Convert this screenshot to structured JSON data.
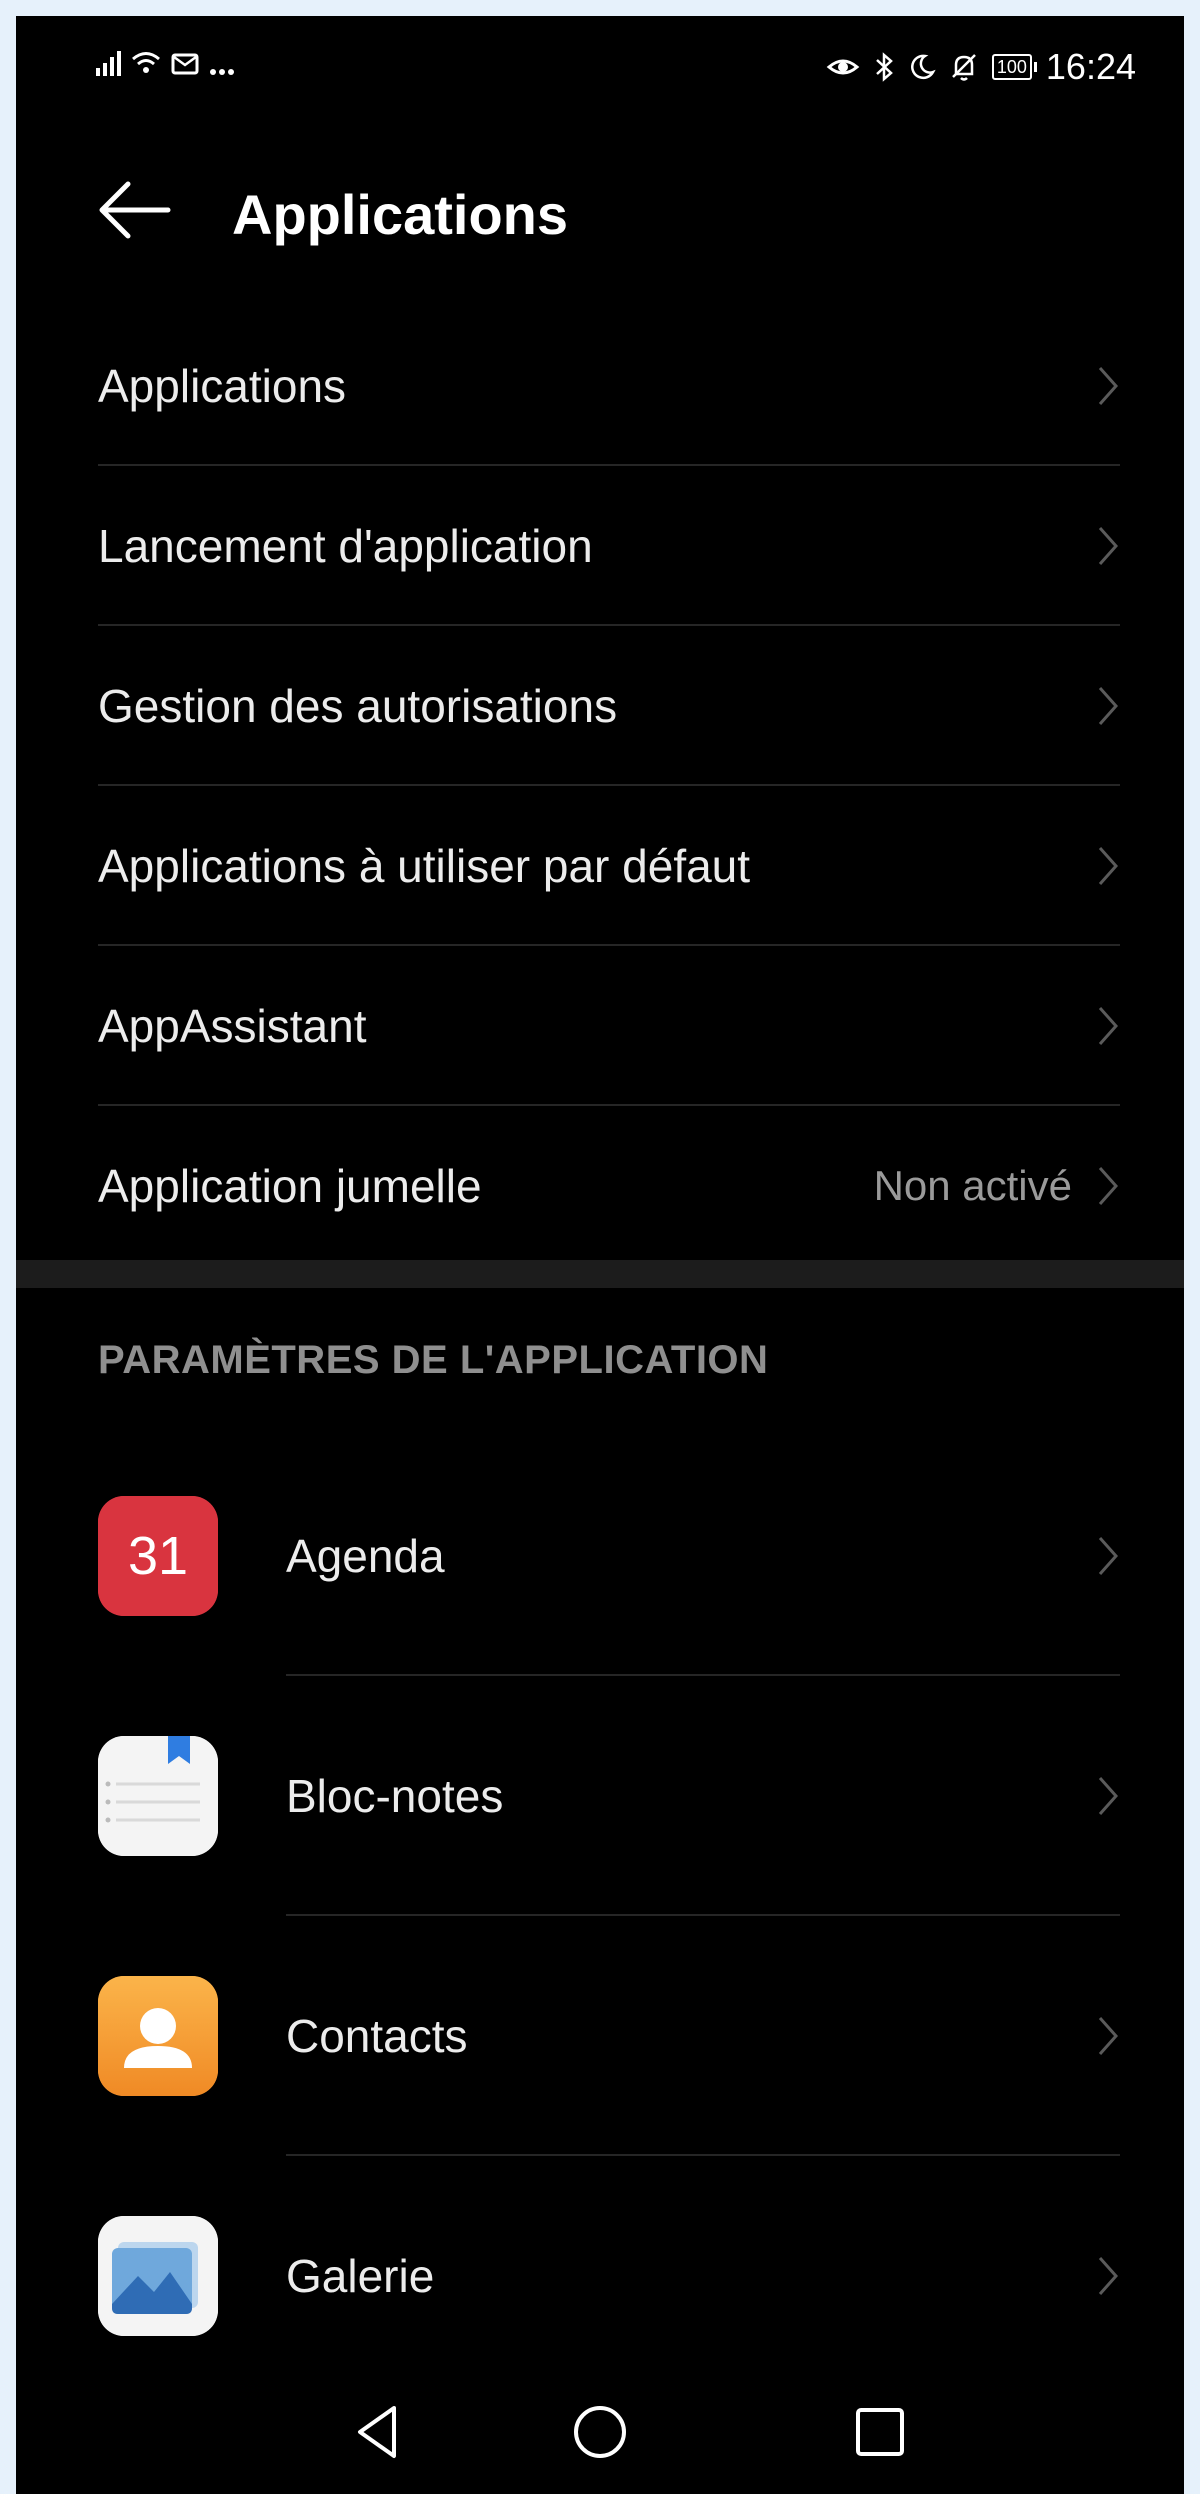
{
  "status_bar": {
    "left_icons": [
      "signal-icon",
      "wifi-icon",
      "message-icon",
      "more-dots-icon"
    ],
    "right_icons": [
      "eye-comfort-icon",
      "bluetooth-icon",
      "do-not-disturb-icon",
      "mute-icon"
    ],
    "battery": "100",
    "time": "16:24"
  },
  "header": {
    "title": "Applications"
  },
  "menu": {
    "items": [
      {
        "label": "Applications",
        "value": ""
      },
      {
        "label": "Lancement d'application",
        "value": ""
      },
      {
        "label": "Gestion des autorisations",
        "value": ""
      },
      {
        "label": "Applications à utiliser par défaut",
        "value": ""
      },
      {
        "label": "AppAssistant",
        "value": ""
      },
      {
        "label": "Application jumelle",
        "value": "Non activé"
      }
    ]
  },
  "section": {
    "title": "PARAMÈTRES DE L'APPLICATION"
  },
  "apps": {
    "items": [
      {
        "name": "Agenda",
        "icon": "calendar-icon",
        "icon_text": "31",
        "color": "#d9343f"
      },
      {
        "name": "Bloc-notes",
        "icon": "notepad-icon",
        "color": "#ffffff"
      },
      {
        "name": "Contacts",
        "icon": "contacts-icon",
        "color": "#f7a23a"
      },
      {
        "name": "Galerie",
        "icon": "gallery-icon",
        "color": "#ffffff"
      }
    ]
  },
  "nav_bar": {
    "buttons": [
      "back-nav-icon",
      "home-nav-icon",
      "recents-nav-icon"
    ]
  },
  "colors": {
    "background": "#000000",
    "text": "#ececec",
    "secondary_text": "#9a9a9a",
    "divider": "#262626",
    "page_background": "#e6f1fb"
  }
}
